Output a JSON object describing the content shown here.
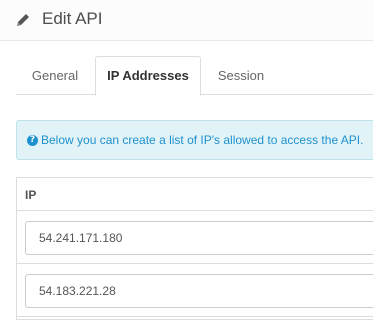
{
  "header": {
    "title": "Edit API",
    "icon": "pencil-icon"
  },
  "tabs": [
    {
      "label": "General",
      "active": false
    },
    {
      "label": "IP Addresses",
      "active": true
    },
    {
      "label": "Session",
      "active": false
    }
  ],
  "info": {
    "icon": "question-circle-icon",
    "text": "Below you can create a list of IP's allowed to access the API."
  },
  "table": {
    "header": "IP",
    "rows": [
      {
        "value": "54.241.171.180"
      },
      {
        "value": "54.183.221.28"
      }
    ]
  },
  "colors": {
    "accent": "#1e91cf",
    "info_bg": "#e1f3f7"
  }
}
